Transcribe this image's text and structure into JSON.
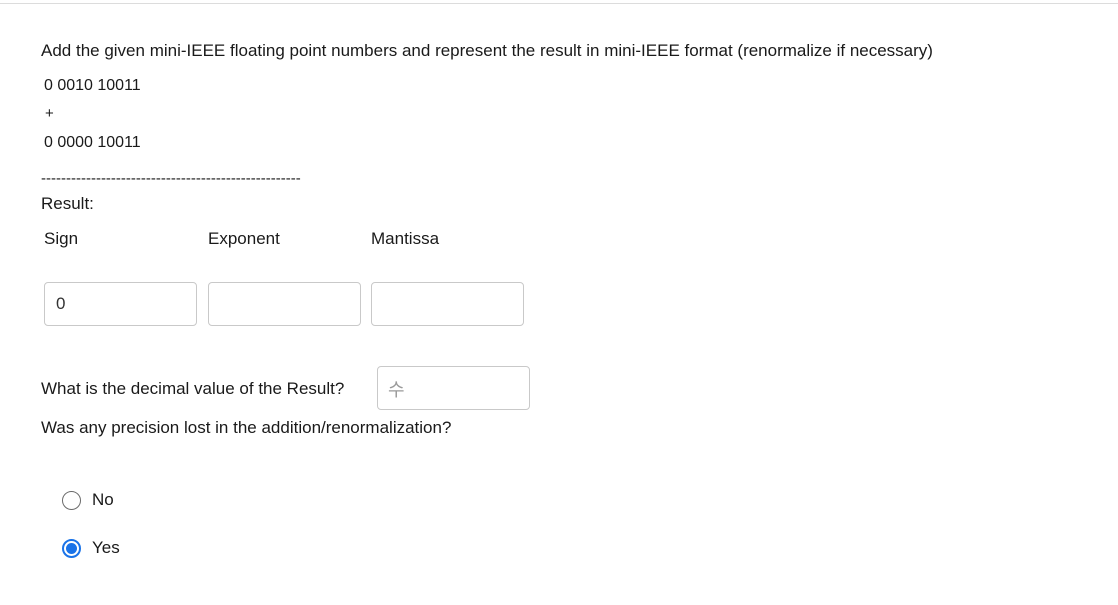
{
  "question": {
    "prompt": "Add the given mini-IEEE floating point numbers and represent the result in mini-IEEE format (renormalize if necessary)",
    "operand1": "0 0010 10011",
    "operator": "+",
    "operand2": "0 0000 10011",
    "separator": "----------------------------------------------------"
  },
  "result": {
    "label": "Result:",
    "headers": {
      "sign": "Sign",
      "exponent": "Exponent",
      "mantissa": "Mantissa"
    },
    "values": {
      "sign": "0",
      "exponent": "",
      "mantissa": ""
    }
  },
  "decimal": {
    "question": "What is the decimal value of the Result?",
    "value": "",
    "input_glyph": "수"
  },
  "precision": {
    "question": "Was any precision lost in the addition/renormalization?",
    "options": [
      {
        "label": "No",
        "selected": false
      },
      {
        "label": "Yes",
        "selected": true
      }
    ]
  },
  "colors": {
    "accent": "#1a73e8",
    "border": "#c9c9c9"
  }
}
